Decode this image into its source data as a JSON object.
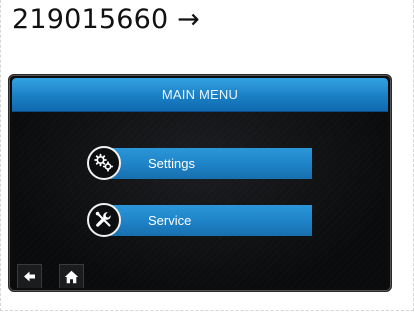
{
  "caption": {
    "text": "219015660 →"
  },
  "header": {
    "title": "MAIN MENU"
  },
  "menu": {
    "items": [
      {
        "label": "Settings",
        "icon": "settings-gears-icon"
      },
      {
        "label": "Service",
        "icon": "service-tools-icon"
      }
    ]
  },
  "navigation": {
    "back_icon": "back-arrow-icon",
    "home_icon": "home-icon"
  },
  "colors": {
    "accent": "#1f84c8",
    "title_bar": "#2a95d6",
    "screen_background": "#0c0d0f",
    "text": "#ffffff"
  }
}
